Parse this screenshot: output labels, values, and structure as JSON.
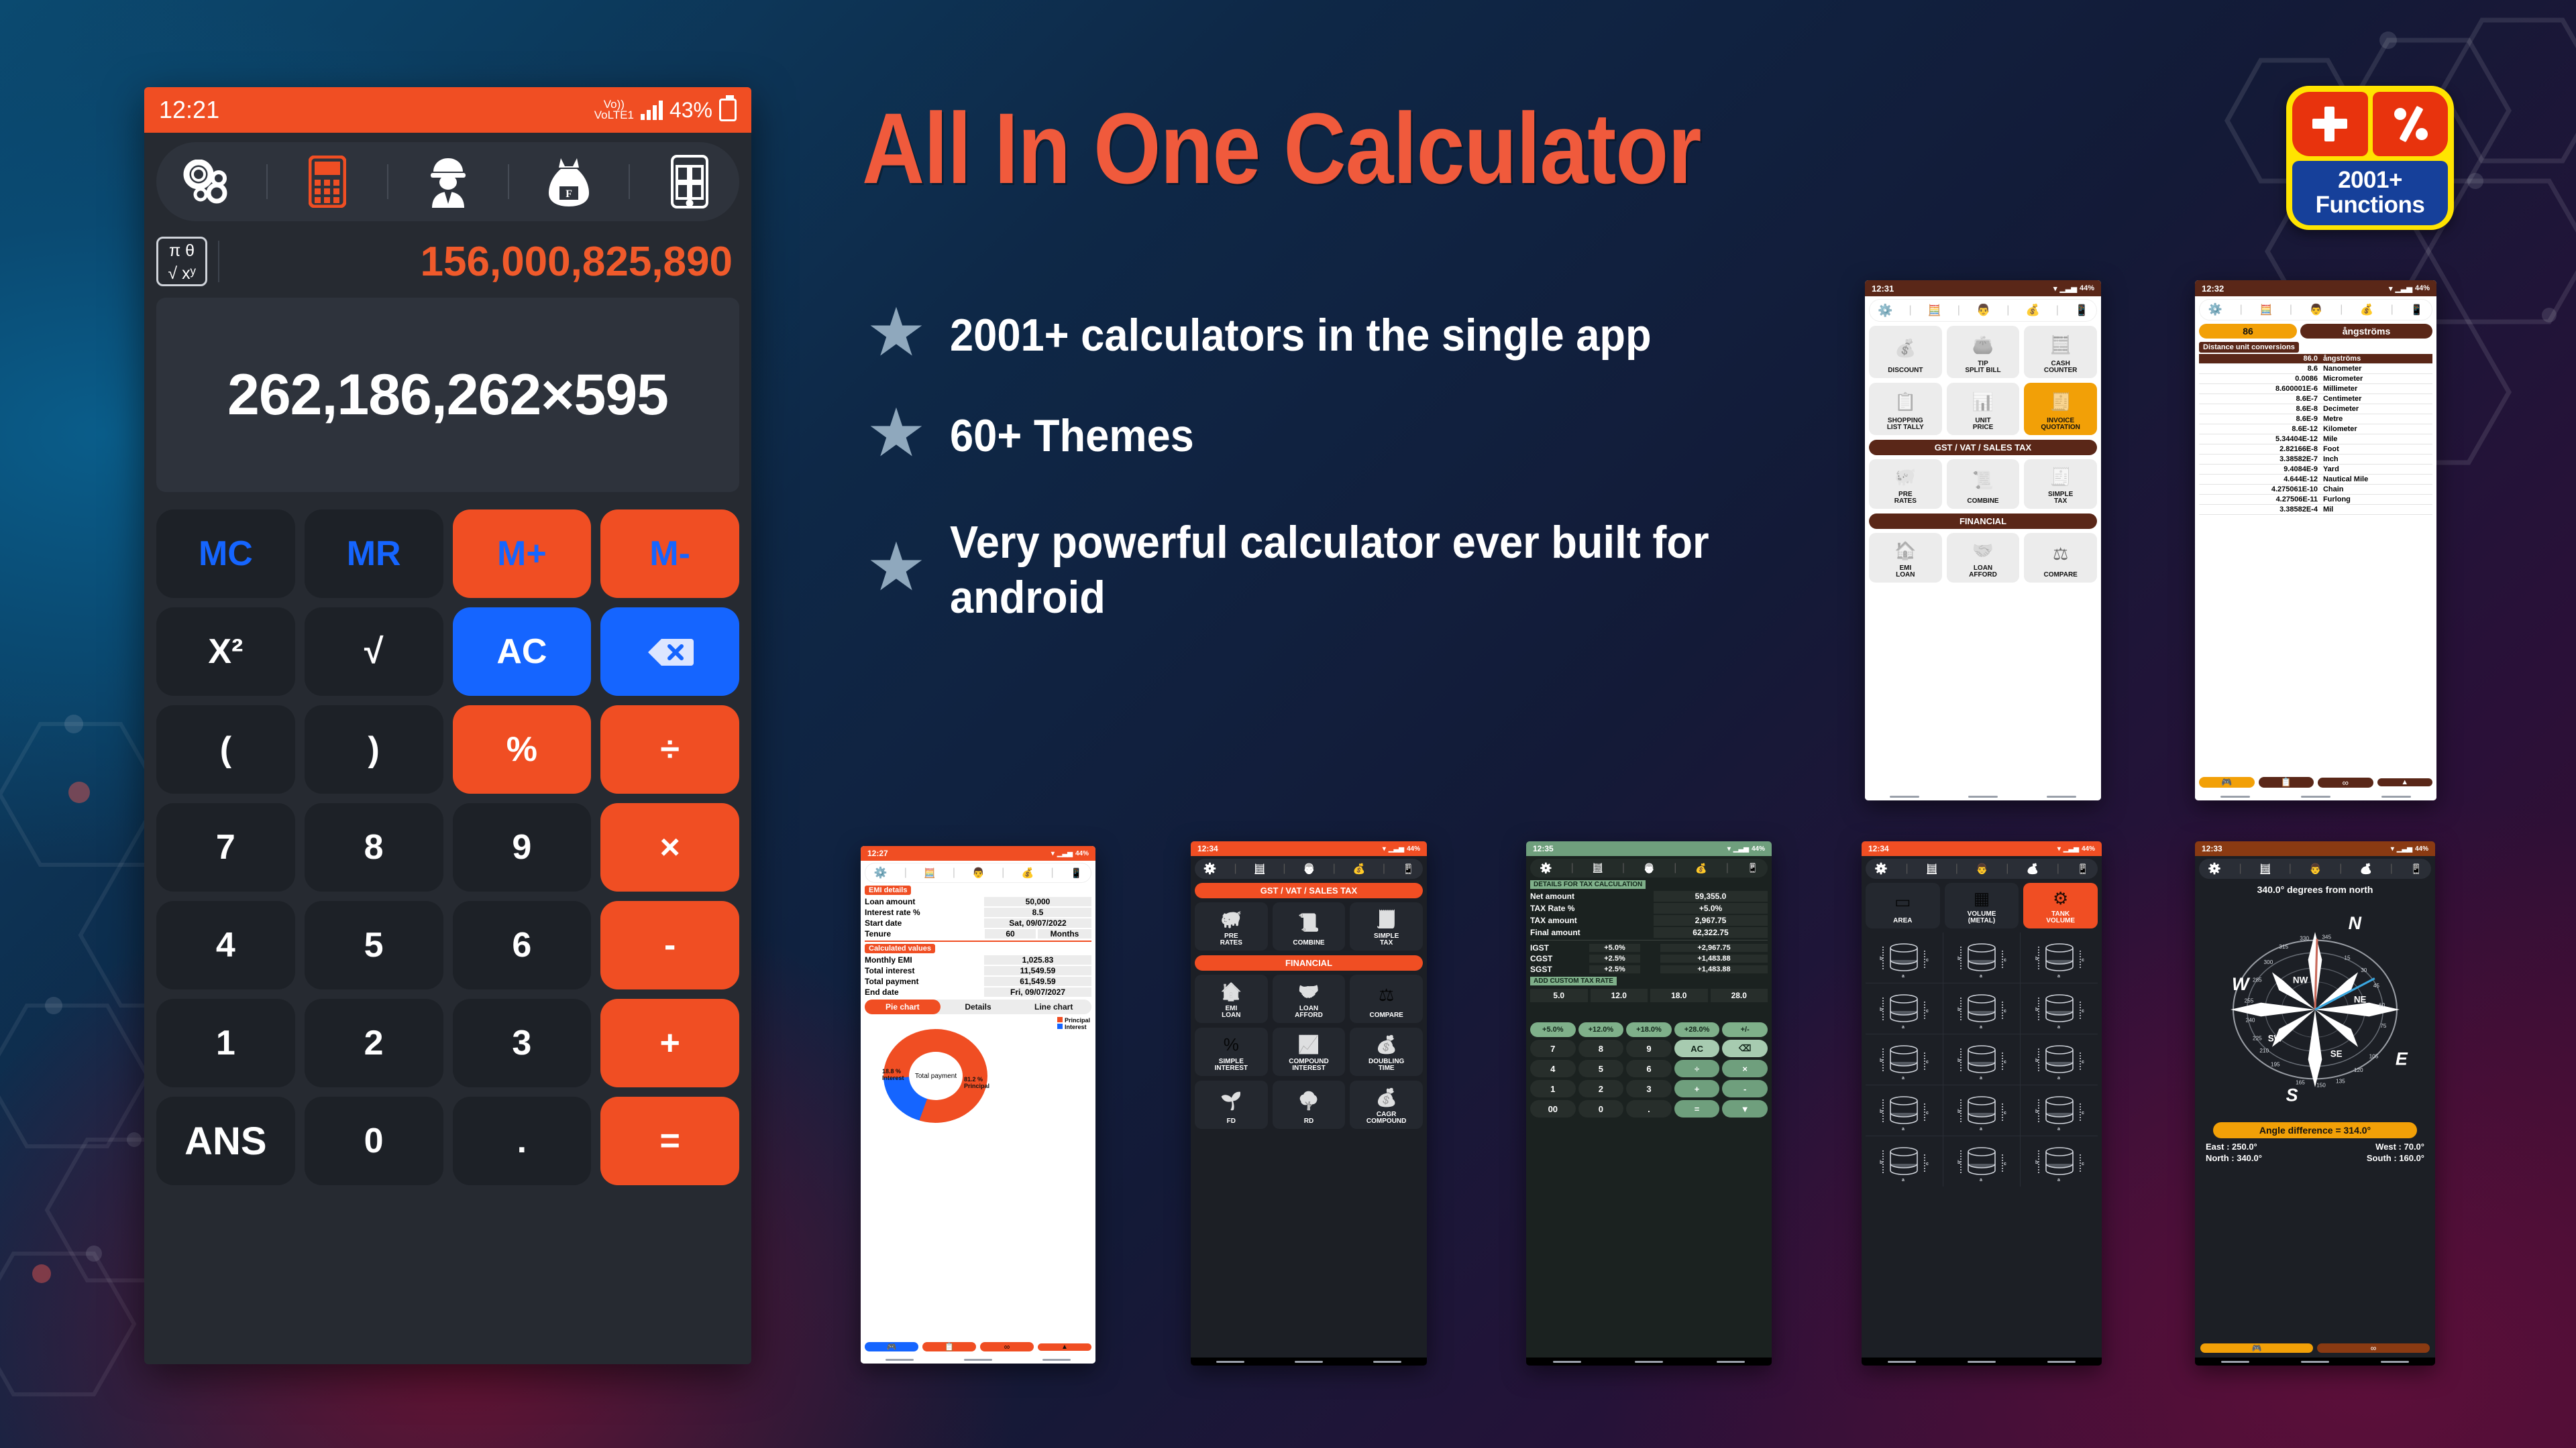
{
  "headline": "All In One Calculator",
  "badge": {
    "count": "2001+",
    "label": "Functions",
    "plus_icon": "plus-icon",
    "percent_icon": "percent-icon"
  },
  "bullets": [
    "2001+ calculators in the single app",
    "60+ Themes",
    "Very powerful calculator ever built for android"
  ],
  "main_phone": {
    "status": {
      "time": "12:21",
      "network": "VoLTE1",
      "battery": "43%"
    },
    "toolbar": [
      "gears-icon",
      "calculator-icon",
      "engineer-icon",
      "moneybag-icon",
      "tools-phone-icon"
    ],
    "mode_box": {
      "line1": "π θ",
      "line2": "√ xʸ"
    },
    "secondary_display": "156,000,825,890",
    "expression": "262,186,262×595",
    "keys": [
      {
        "label": "MC",
        "style": "dark-blue"
      },
      {
        "label": "MR",
        "style": "dark-blue"
      },
      {
        "label": "M+",
        "style": "orange"
      },
      {
        "label": "M-",
        "style": "orange"
      },
      {
        "label": "X²",
        "style": "dark"
      },
      {
        "label": "√",
        "style": "dark"
      },
      {
        "label": "AC",
        "style": "blue"
      },
      {
        "label": "backspace-icon",
        "style": "blue-icon"
      },
      {
        "label": "(",
        "style": "dark"
      },
      {
        "label": ")",
        "style": "dark"
      },
      {
        "label": "%",
        "style": "op"
      },
      {
        "label": "÷",
        "style": "op"
      },
      {
        "label": "7",
        "style": "dark"
      },
      {
        "label": "8",
        "style": "dark"
      },
      {
        "label": "9",
        "style": "dark"
      },
      {
        "label": "×",
        "style": "op"
      },
      {
        "label": "4",
        "style": "dark"
      },
      {
        "label": "5",
        "style": "dark"
      },
      {
        "label": "6",
        "style": "dark"
      },
      {
        "label": "-",
        "style": "op"
      },
      {
        "label": "1",
        "style": "dark"
      },
      {
        "label": "2",
        "style": "dark"
      },
      {
        "label": "3",
        "style": "dark"
      },
      {
        "label": "+",
        "style": "op"
      },
      {
        "label": "ANS",
        "style": "dark"
      },
      {
        "label": "0",
        "style": "dark"
      },
      {
        "label": ".",
        "style": "dark"
      },
      {
        "label": "=",
        "style": "op"
      }
    ]
  },
  "phone_finance_light": {
    "status": {
      "time": "12:31",
      "battery": "44%"
    },
    "tiles_top": [
      {
        "label": "DISCOUNT",
        "icon": "hand-coin-icon",
        "highlight": false
      },
      {
        "label": "TIP\nSPLIT BILL",
        "icon": "wallet-icon",
        "highlight": false
      },
      {
        "label": "CASH\nCOUNTER",
        "icon": "calculator-coin-icon",
        "highlight": false
      },
      {
        "label": "SHOPPING\nLIST TALLY",
        "icon": "clipboard-check-icon",
        "highlight": false
      },
      {
        "label": "UNIT\nPRICE",
        "icon": "compare-chart-icon",
        "highlight": false
      },
      {
        "label": "INVOICE\nQUOTATION",
        "icon": "invoice-icon",
        "highlight": true
      }
    ],
    "section1": "GST / VAT / SALES TAX",
    "tiles_tax": [
      {
        "label": "PRE\nRATES",
        "icon": "piggy-tax-icon"
      },
      {
        "label": "COMBINE",
        "icon": "tax-book-icon"
      },
      {
        "label": "SIMPLE\nTAX",
        "icon": "receipt-percent-icon"
      }
    ],
    "section2": "FINANCIAL",
    "tiles_fin": [
      {
        "label": "EMI\nLOAN",
        "icon": "house-emi-icon"
      },
      {
        "label": "LOAN\nAFFORD",
        "icon": "handshake-icon"
      },
      {
        "label": "COMPARE",
        "icon": "balance-scale-icon"
      }
    ]
  },
  "phone_units": {
    "status": {
      "time": "12:32",
      "battery": "44%"
    },
    "input_value": "86",
    "input_unit": "ångströms",
    "table_title": "Distance unit conversions",
    "rows": [
      {
        "value": "86.0",
        "unit": "ångströms",
        "selected": true
      },
      {
        "value": "8.6",
        "unit": "Nanometer",
        "selected": false
      },
      {
        "value": "0.0086",
        "unit": "Micrometer",
        "selected": false
      },
      {
        "value": "8.600001E-6",
        "unit": "Millimeter",
        "selected": false
      },
      {
        "value": "8.6E-7",
        "unit": "Centimeter",
        "selected": false
      },
      {
        "value": "8.6E-8",
        "unit": "Decimeter",
        "selected": false
      },
      {
        "value": "8.6E-9",
        "unit": "Metre",
        "selected": false
      },
      {
        "value": "8.6E-12",
        "unit": "Kilometer",
        "selected": false
      },
      {
        "value": "5.34404E-12",
        "unit": "Mile",
        "selected": false
      },
      {
        "value": "2.82166E-8",
        "unit": "Foot",
        "selected": false
      },
      {
        "value": "3.38582E-7",
        "unit": "Inch",
        "selected": false
      },
      {
        "value": "9.4084E-9",
        "unit": "Yard",
        "selected": false
      },
      {
        "value": "4.644E-12",
        "unit": "Nautical Mile",
        "selected": false
      },
      {
        "value": "4.275061E-10",
        "unit": "Chain",
        "selected": false
      },
      {
        "value": "4.27506E-11",
        "unit": "Furlong",
        "selected": false
      },
      {
        "value": "3.38582E-4",
        "unit": "Mil",
        "selected": false
      }
    ],
    "bottom_buttons": [
      "games-icon",
      "clipboard-icon",
      "share-icon",
      "up-arrow-icon"
    ]
  },
  "phone_emi": {
    "status": {
      "time": "12:27",
      "battery": "44%"
    },
    "section_details": "EMI details",
    "details": [
      {
        "label": "Loan amount",
        "value": "50,000"
      },
      {
        "label": "Interest rate %",
        "value": "8.5"
      },
      {
        "label": "Start date",
        "value": "Sat, 09/07/2022"
      }
    ],
    "tenure_label": "Tenure",
    "tenure_value": "60",
    "tenure_unit": "Months",
    "section_calc": "Calculated values",
    "calculated": [
      {
        "label": "Monthly EMI",
        "value": "1,025.83"
      },
      {
        "label": "Total interest",
        "value": "11,549.59"
      },
      {
        "label": "Total payment",
        "value": "61,549.59"
      },
      {
        "label": "End date",
        "value": "Fri, 09/07/2027"
      }
    ],
    "tabs": [
      "Pie chart",
      "Details",
      "Line chart"
    ],
    "active_tab": "Pie chart",
    "legend": [
      "Principal",
      "Interest"
    ],
    "chart_center": "Total payment",
    "slice_interest": "18.8 %\nInterest",
    "slice_principal": "81.2 %\nPrincipal",
    "bottom_buttons": [
      "games-icon",
      "clipboard-icon",
      "share-icon",
      "up-arrow-icon"
    ]
  },
  "phone_gst_dark": {
    "status": {
      "time": "12:34",
      "battery": "44%"
    },
    "section1": "GST / VAT / SALES TAX",
    "tiles_tax": [
      {
        "label": "PRE\nRATES",
        "icon": "piggy-tax-icon"
      },
      {
        "label": "COMBINE",
        "icon": "tax-book-icon"
      },
      {
        "label": "SIMPLE\nTAX",
        "icon": "receipt-percent-icon"
      }
    ],
    "section2": "FINANCIAL",
    "tiles_fin": [
      {
        "label": "EMI\nLOAN",
        "icon": "house-emi-icon"
      },
      {
        "label": "LOAN\nAFFORD",
        "icon": "handshake-icon"
      },
      {
        "label": "COMPARE",
        "icon": "balance-scale-icon"
      },
      {
        "label": "SIMPLE\nINTEREST",
        "icon": "percent-circle-icon"
      },
      {
        "label": "COMPOUND\nINTEREST",
        "icon": "bar-growth-icon"
      },
      {
        "label": "DOUBLING\nTIME",
        "icon": "coin-split-icon"
      },
      {
        "label": "FD",
        "icon": "fd-plant-icon"
      },
      {
        "label": "RD",
        "icon": "rd-plant-icon"
      },
      {
        "label": "CAGR\nCOMPOUND",
        "icon": "coins-bag-icon"
      }
    ]
  },
  "phone_tax": {
    "status": {
      "time": "12:35",
      "battery": "44%"
    },
    "title": "DETAILS FOR TAX CALCULATION",
    "fields": [
      {
        "label": "Net amount",
        "value": "59,355.0"
      },
      {
        "label": "TAX Rate %",
        "value": "+5.0%"
      },
      {
        "label": "TAX amount",
        "value": "2,967.75"
      },
      {
        "label": "Final amount",
        "value": "62,322.75"
      }
    ],
    "gst_rows": [
      {
        "name": "IGST",
        "rate": "+5.0%",
        "amount": "+2,967.75"
      },
      {
        "name": "CGST",
        "rate": "+2.5%",
        "amount": "+1,483.88"
      },
      {
        "name": "SGST",
        "rate": "+2.5%",
        "amount": "+1,483.88"
      }
    ],
    "custom_title": "ADD CUSTOM TAX RATE",
    "custom_rates": [
      "5.0",
      "12.0",
      "18.0",
      "28.0"
    ],
    "quick_keys": [
      "+5.0%",
      "+12.0%",
      "+18.0%",
      "+28.0%",
      "+/-"
    ],
    "keypad": [
      [
        "7",
        "8",
        "9",
        "AC",
        "backspace-icon"
      ],
      [
        "4",
        "5",
        "6",
        "÷",
        "×"
      ],
      [
        "1",
        "2",
        "3",
        "+",
        "-"
      ],
      [
        "00",
        "0",
        ".",
        "=",
        "down-arrow-icon"
      ]
    ]
  },
  "phone_volume": {
    "status": {
      "time": "12:34",
      "battery": "44%"
    },
    "tiles_top": [
      {
        "label": "AREA",
        "icon": "area-icon",
        "highlight": false
      },
      {
        "label": "VOLUME\n(METAL)",
        "icon": "cube-icon",
        "highlight": false
      },
      {
        "label": "TANK\nVOLUME",
        "icon": "tank-icon",
        "highlight": true
      }
    ],
    "shape_rows": 5
  },
  "phone_compass": {
    "status": {
      "time": "12:33",
      "battery": "44%"
    },
    "heading": "340.0° degrees from north",
    "angle_diff": "Angle difference = 314.0°",
    "readouts": [
      {
        "label": "East : 250.0°"
      },
      {
        "label": "West : 70.0°"
      },
      {
        "label": "North : 340.0°"
      },
      {
        "label": "South : 160.0°"
      }
    ],
    "cardinals": [
      "N",
      "NE",
      "E",
      "SE",
      "S",
      "SW",
      "W",
      "NW"
    ],
    "bottom_buttons": [
      "games-icon",
      "share-icon"
    ]
  },
  "colors": {
    "orange": "#f04e23",
    "blue": "#1565ff",
    "brown": "#5a2718",
    "amber": "#f2a007",
    "green": "#7fb08a",
    "yellow": "#ffe400"
  }
}
